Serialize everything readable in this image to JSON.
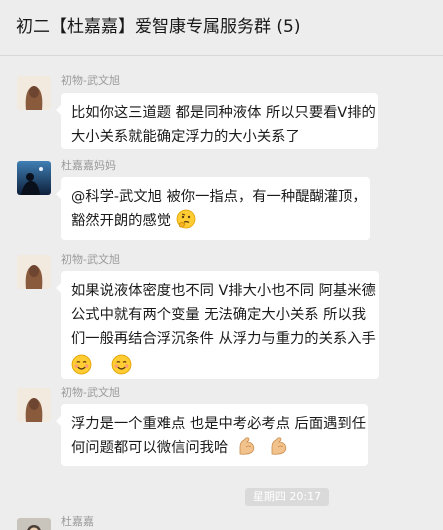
{
  "header": {
    "title": "初二【杜嘉嘉】爱智康专属服务群 (5)"
  },
  "messages": [
    {
      "sender": "初物-武文旭",
      "avatar": "long-hair-girl-avatar",
      "lines": [
        "比如你这三道题 都是同种液体 所以只要看V排的",
        "大小关系就能确定浮力的大小关系了"
      ]
    },
    {
      "sender": "杜嘉嘉妈妈",
      "avatar": "night-sky-person-avatar",
      "lines": [
        "@科学-武文旭 被你一指点，有一种醍醐灌顶，",
        "豁然开朗的感觉"
      ],
      "emojis": [
        "thinking-face-emoji"
      ]
    },
    {
      "sender": "初物-武文旭",
      "avatar": "long-hair-girl-avatar",
      "lines": [
        "如果说液体密度也不同 V排大小也不同 阿基米德",
        "公式中就有两个变量 无法确定大小关系 所以我",
        "们一般再结合浮沉条件 从浮力与重力的关系入手"
      ],
      "emojis": [
        "smiling-face-emoji",
        "smiling-face-emoji"
      ]
    },
    {
      "sender": "初物-武文旭",
      "avatar": "long-hair-girl-avatar",
      "lines": [
        "浮力是一个重难点 也是中考必考点 后面遇到任",
        "何问题都可以微信问我哈"
      ],
      "emojis": [
        "flexed-biceps-emoji",
        "flexed-biceps-emoji"
      ]
    },
    {
      "sender": "杜嘉嘉",
      "avatar": "person-avatar"
    }
  ],
  "timestamp": "星期四 20:17",
  "colors": {
    "background": "#ededed",
    "bubble": "#ffffff",
    "sender": "#9a9a9a"
  }
}
